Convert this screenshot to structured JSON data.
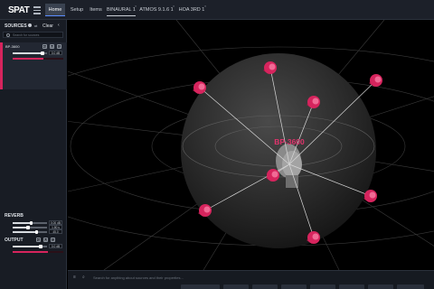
{
  "app": {
    "logo": "SPAT"
  },
  "tabs": [
    {
      "label": "Home",
      "active": true,
      "sup": ""
    },
    {
      "label": "Setup",
      "active": false,
      "sup": ""
    },
    {
      "label": "Items",
      "active": false,
      "sup": ""
    },
    {
      "label": "BINAURAL 1",
      "active": false,
      "sup": "≡"
    },
    {
      "label": "ATMOS 9.1.6 1",
      "active": false,
      "sup": "≡"
    },
    {
      "label": "HOA 3RD 1",
      "active": false,
      "sup": "≡"
    }
  ],
  "sources": {
    "title": "SOURCES",
    "clear_label": "Clear",
    "search_placeholder": "Search for sources",
    "item": {
      "name": "BP-3600",
      "gain_value": "0.0 dB",
      "meter_level": 0.6
    }
  },
  "reverb": {
    "title": "REVERB",
    "rows": [
      {
        "value": "0.00 dB",
        "level": 0.55
      },
      {
        "value": "1.80 s",
        "level": 0.45
      },
      {
        "value": "45.0",
        "level": 0.7
      }
    ]
  },
  "output": {
    "title": "OUTPUT",
    "gain_value": "0.0 dB",
    "meter_level": 0.7
  },
  "viewport": {
    "source_label": "BP-3600",
    "accent_color": "#e0336c",
    "speaker_color": "#d6245d"
  },
  "bottombar": {
    "search_placeholder": "Search for anything about sources and their properties..."
  }
}
